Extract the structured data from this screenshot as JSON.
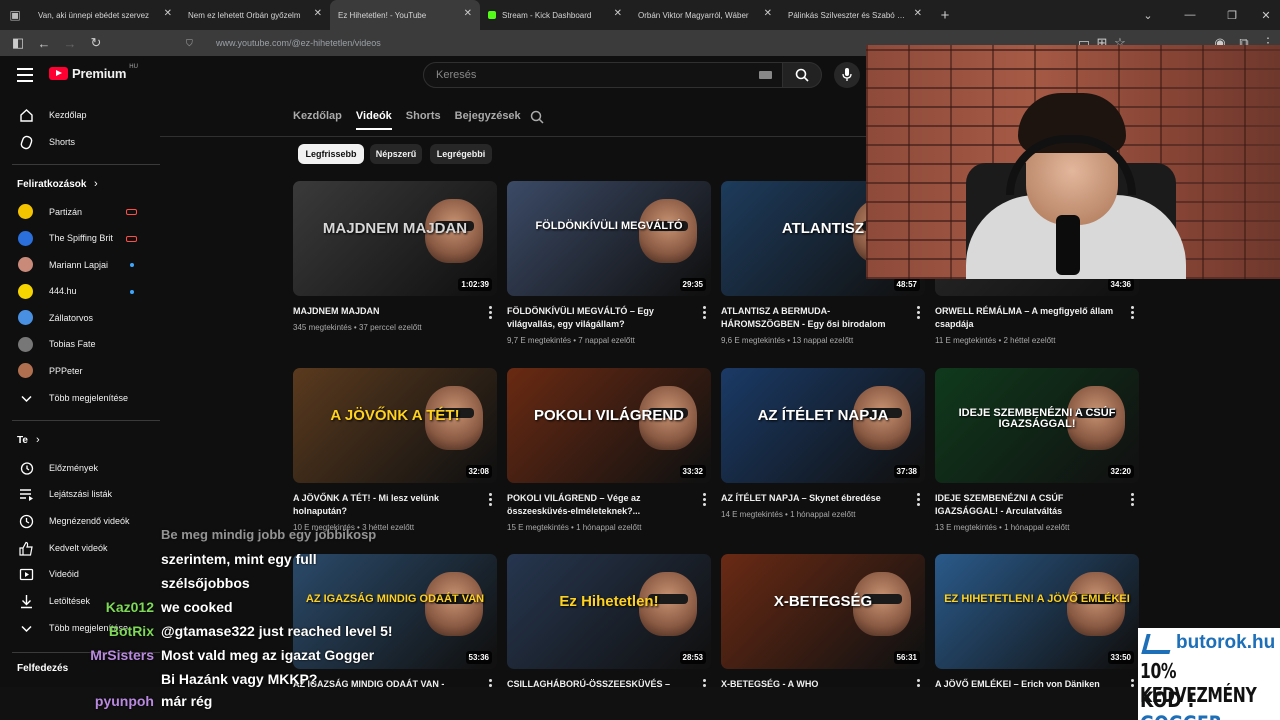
{
  "browser": {
    "tabs": [
      {
        "title": "Van, aki ünnepi ebédet szervez",
        "icon": "youtube-icon"
      },
      {
        "title": "Nem ez lehetett Orbán győzelm",
        "icon": "youtube-icon"
      },
      {
        "title": "Ez Hihetetlen! - YouTube",
        "icon": "youtube-icon",
        "active": true
      },
      {
        "title": "Stream - Kick Dashboard",
        "icon": "kick-icon"
      },
      {
        "title": "Orbán Viktor Magyarról, Wáber",
        "icon": "youtube-icon"
      },
      {
        "title": "Pálinkás Szilveszter és Szabó Be",
        "icon": "youtube-icon"
      }
    ],
    "new_tab": "+",
    "url": "www.youtube.com/@ez-hihetetlen/videos"
  },
  "youtube": {
    "logo_text": "Premium",
    "country_code": "HU",
    "search_placeholder": "Keresés",
    "sidebar": {
      "main": [
        {
          "label": "Kezdőlap",
          "icon": "home-icon"
        },
        {
          "label": "Shorts",
          "icon": "shorts-icon"
        }
      ],
      "subscriptions_title": "Feliratkozások",
      "subscriptions": [
        {
          "label": "Partizán",
          "status": "live",
          "color": "#f5c400"
        },
        {
          "label": "The Spiffing Brit",
          "status": "live",
          "color": "#2a6fdb"
        },
        {
          "label": "Mariann Lapjai",
          "status": "new",
          "color": "#c98a7a"
        },
        {
          "label": "444.hu",
          "status": "new",
          "color": "#f5d400"
        },
        {
          "label": "Zállatorvos",
          "status": "",
          "color": "#4a90e2"
        },
        {
          "label": "Tobias Fate",
          "status": "",
          "color": "#777777"
        },
        {
          "label": "PPPeter",
          "status": "",
          "color": "#b07050"
        }
      ],
      "more_subs": "Több megjelenítése",
      "you_title": "Te",
      "you": [
        {
          "label": "Előzmények",
          "icon": "history-icon"
        },
        {
          "label": "Lejátszási listák",
          "icon": "playlist-icon"
        },
        {
          "label": "Megnézendő videók",
          "icon": "clock-icon"
        },
        {
          "label": "Kedvelt videók",
          "icon": "thumbs-up-icon"
        },
        {
          "label": "Videóid",
          "icon": "video-icon"
        },
        {
          "label": "Letöltések",
          "icon": "download-icon"
        },
        {
          "label": "Több megjelenítése",
          "icon": "chevron-down-icon"
        }
      ],
      "explore_title": "Felfedezés"
    },
    "channel_tabs": [
      "Kezdőlap",
      "Videók",
      "Shorts",
      "Bejegyzések"
    ],
    "active_tab": "Videók",
    "chips": [
      "Legfrissebb",
      "Népszerű",
      "Legrégebbi"
    ],
    "videos": [
      {
        "title": "MAJDNEM MAJDAN",
        "views": "345 megtekintés",
        "age": "37 perccel ezelőtt",
        "duration": "1:02:39",
        "thumb_text": "MAJDNEM MAJDAN",
        "thumb_bg": "#3a3a3a",
        "thumb_fg": "#d8d8d8"
      },
      {
        "title": "FÖLDÖNKÍVÜLI MEGVÁLTÓ – Egy világvallás, egy világállam?",
        "views": "9,7 E megtekintés",
        "age": "7 nappal ezelőtt",
        "duration": "29:35",
        "thumb_text": "FÖLDÖNKÍVÜLI MEGVÁLTÓ",
        "thumb_bg": "#3b4a66",
        "thumb_fg": "#ffffff"
      },
      {
        "title": "ATLANTISZ A BERMUDA-HÁROMSZÖGBEN - Egy ősi birodalom tündöklése és bukása",
        "views": "9,6 E megtekintés",
        "age": "13 nappal ezelőtt",
        "duration": "48:57",
        "thumb_text": "ATLANTISZ",
        "thumb_bg": "#1d3b5c",
        "thumb_fg": "#ffffff"
      },
      {
        "title": "ORWELL RÉMÁLMA – A megfigyelő állam csapdája",
        "views": "11 E megtekintés",
        "age": "2 héttel ezelőtt",
        "duration": "34:36",
        "thumb_text": "",
        "thumb_bg": "#2a2a2a",
        "thumb_fg": "#ffd21f"
      },
      {
        "title": "A JÖVŐNK A TÉT! - Mi lesz velünk holnapután?",
        "views": "10 E megtekintés",
        "age": "3 héttel ezelőtt",
        "duration": "32:08",
        "thumb_text": "A JÖVŐNK A TÉT!",
        "thumb_bg": "#5a3a1e",
        "thumb_fg": "#ffd21f"
      },
      {
        "title": "POKOLI VILÁGREND – Vége az összeesküvés-elméleteknek?...",
        "views": "15 E megtekintés",
        "age": "1 hónappal ezelőtt",
        "duration": "33:32",
        "thumb_text": "POKOLI VILÁGREND",
        "thumb_bg": "#6a2a12",
        "thumb_fg": "#ffffff"
      },
      {
        "title": "AZ ÍTÉLET NAPJA – Skynet ébredése",
        "views": "14 E megtekintés",
        "age": "1 hónappal ezelőtt",
        "duration": "37:38",
        "thumb_text": "AZ ÍTÉLET NAPJA",
        "thumb_bg": "#1a3a66",
        "thumb_fg": "#ffffff"
      },
      {
        "title": "IDEJE SZEMBENÉZNI A CSÚF IGAZSÁGGAL! - Arculatváltás",
        "views": "13 E megtekintés",
        "age": "1 hónappal ezelőtt",
        "duration": "32:20",
        "thumb_text": "IDEJE SZEMBENÉZNI A CSÚF IGAZSÁGGAL!",
        "thumb_bg": "#0f3a1c",
        "thumb_fg": "#ffffff"
      },
      {
        "title": "AZ IGAZSÁG MINDIG ODAÁT VAN -",
        "views": "",
        "age": "",
        "duration": "53:36",
        "thumb_text": "AZ IGAZSÁG MINDIG ODAÁT VAN",
        "thumb_bg": "#2a4a6a",
        "thumb_fg": "#ffd21f"
      },
      {
        "title": "CSILLAGHÁBORÚ-ÖSSZEESKÜVÉS –",
        "views": "",
        "age": "",
        "duration": "28:53",
        "thumb_text": "Ez Hihetetlen!",
        "thumb_bg": "#26364f",
        "thumb_fg": "#ffd21f"
      },
      {
        "title": "X-BETEGSÉG - A WHO népességcsökkentési",
        "views": "",
        "age": "",
        "duration": "56:31",
        "thumb_text": "X-BETEGSÉG",
        "thumb_bg": "#6a2a14",
        "thumb_fg": "#ffffff"
      },
      {
        "title": "A JÖVŐ EMLÉKEI – Erich von Däniken",
        "views": "",
        "age": "",
        "duration": "33:50",
        "thumb_text": "EZ HIHETETLEN! A JÖVŐ EMLÉKEI",
        "thumb_bg": "#2a5a8a",
        "thumb_fg": "#ffd21f"
      }
    ]
  },
  "chat": [
    {
      "user": "",
      "text": "szerintem, mint egy full",
      "color": "#ffffff"
    },
    {
      "user": "",
      "text": "szélsőjobbos",
      "color": "#ffffff"
    },
    {
      "user": "Kaz012",
      "text": "we cooked",
      "color": "#7ed957"
    },
    {
      "user": "BotRix",
      "text": "@gtamase322 just reached level 5!",
      "color": "#7ed957"
    },
    {
      "user": "MrSisters",
      "text": "Most vald meg az igazat Gogger",
      "color": "#b98ae0"
    },
    {
      "user": "",
      "text": "Bi Hazánk vagy MKKP?",
      "color": "#ffffff"
    },
    {
      "user": "pyunpoh",
      "text": "már rég",
      "color": "#b98ae0"
    }
  ],
  "chat_partial_top": "Be meg mindig jobb egy jobbikosp",
  "ad": {
    "brand": "butorok.hu",
    "line1": "10% KEDVEZMÉNY",
    "line2_prefix": "KÓD : ",
    "line2_code": "GOGGER"
  }
}
